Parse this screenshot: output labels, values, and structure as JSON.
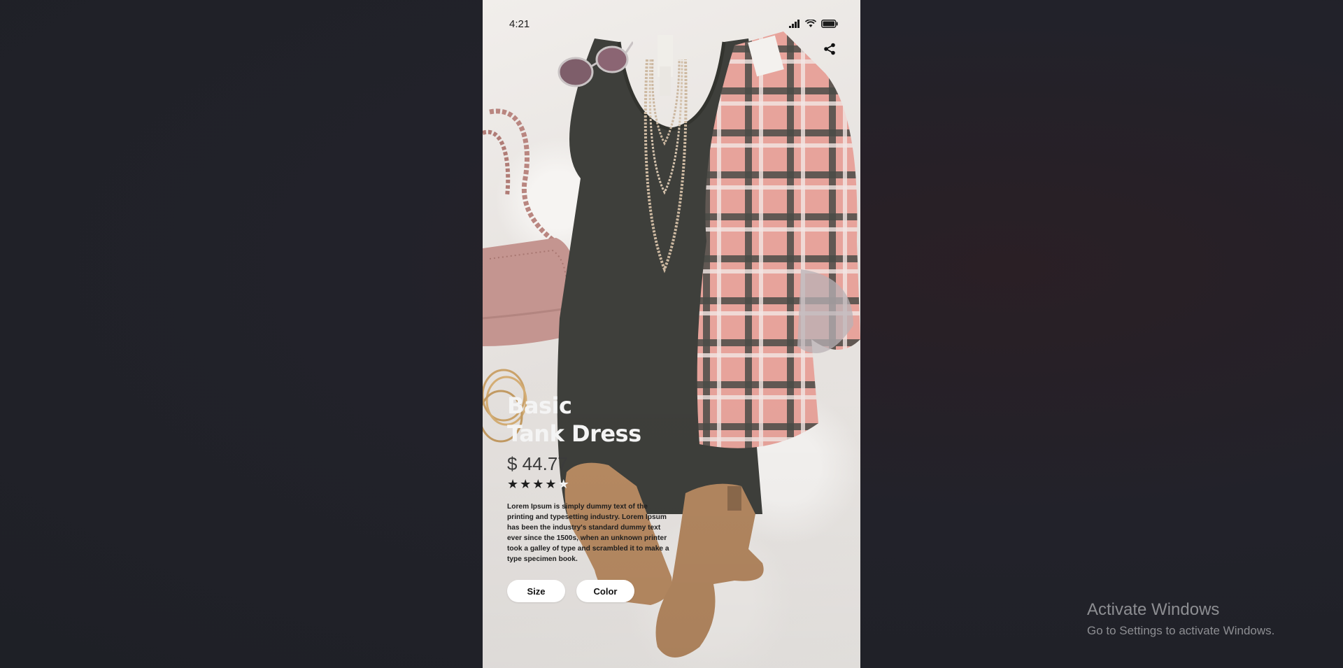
{
  "status_bar": {
    "time": "4:21",
    "icons": [
      "signal-icon",
      "wifi-icon",
      "battery-icon"
    ]
  },
  "header": {
    "share_icon": "share-icon"
  },
  "product": {
    "title_line1": "Basic",
    "title_line2": "Tank Dress",
    "price": "$ 44.77",
    "rating": 4,
    "rating_max": 5,
    "description": "Lorem Ipsum is simply dummy text of the printing and typesetting industry. Lorem Ipsum has been the industry's standard dummy text ever since the 1500s, when an unknown printer took a galley of type and scrambled it to make a type specimen book."
  },
  "options": {
    "size_label": "Size",
    "color_label": "Color"
  },
  "watermark": {
    "title": "Activate Windows",
    "subtitle": "Go to Settings to activate Windows."
  },
  "colors": {
    "desktop_bg": "#1f2126",
    "title_text": "#f4f4f4",
    "price_text": "#3b3b3b",
    "button_bg": "#ffffff",
    "star_filled": "#1d1d1d",
    "star_empty": "#f3f3f3"
  }
}
